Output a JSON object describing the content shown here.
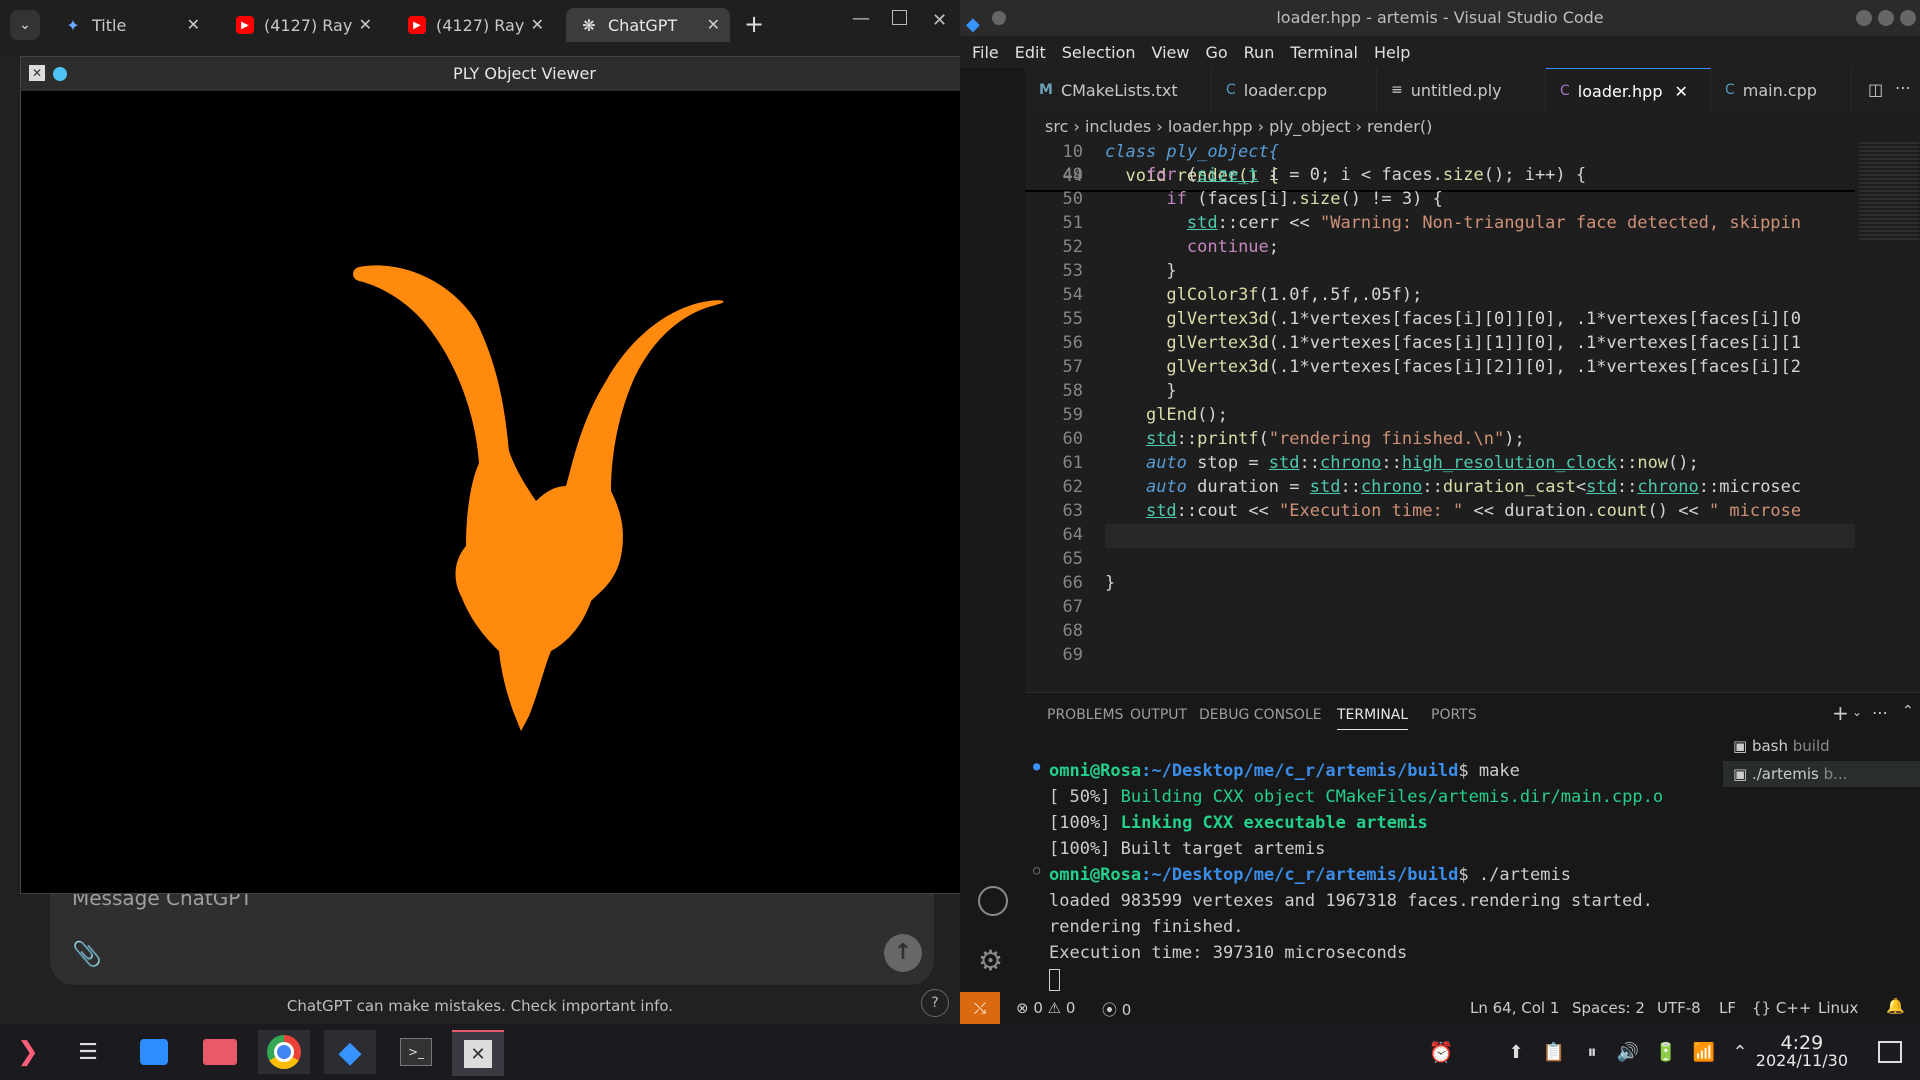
{
  "browser": {
    "tabs": [
      {
        "label": "Title"
      },
      {
        "label": "(4127) Ray"
      },
      {
        "label": "(4127) Ray"
      },
      {
        "label": "ChatGPT"
      }
    ],
    "message_placeholder": "Message ChatGPT",
    "disclaimer": "ChatGPT can make mistakes. Check important info.",
    "help_label": "?"
  },
  "viewer": {
    "title": "PLY Object Viewer",
    "model_color": "#ff8a0d"
  },
  "vscode": {
    "title": "loader.hpp - artemis - Visual Studio Code",
    "menu": [
      "File",
      "Edit",
      "Selection",
      "View",
      "Go",
      "Run",
      "Terminal",
      "Help"
    ],
    "tabs": [
      {
        "label": "CMakeLists.txt",
        "icon": "M"
      },
      {
        "label": "loader.cpp",
        "icon": "C"
      },
      {
        "label": "untitled.ply",
        "icon": "≡"
      },
      {
        "label": "loader.hpp",
        "icon": "C"
      },
      {
        "label": "main.cpp",
        "icon": "C"
      }
    ],
    "breadcrumb": {
      "folder1": "src",
      "folder2": "includes",
      "file": "loader.hpp",
      "symbol1": "ply_object",
      "symbol2": "render()"
    },
    "sticky": [
      {
        "num": "10",
        "text": "class ply_object{"
      },
      {
        "num": "44",
        "text": "  void render() {"
      }
    ],
    "code": [
      {
        "num": "49",
        "text": "    for (size_t i = 0; i < faces.size(); i++) {"
      },
      {
        "num": "50",
        "text": "      if (faces[i].size() != 3) {"
      },
      {
        "num": "51",
        "text": "        std::cerr << \"Warning: Non-triangular face detected, skippin"
      },
      {
        "num": "52",
        "text": "        continue;"
      },
      {
        "num": "53",
        "text": "      }"
      },
      {
        "num": "54",
        "text": "      glColor3f(1.0f,.5f,.05f);"
      },
      {
        "num": "55",
        "text": "      glVertex3d(.1*vertexes[faces[i][0]][0], .1*vertexes[faces[i][0"
      },
      {
        "num": "56",
        "text": "      glVertex3d(.1*vertexes[faces[i][1]][0], .1*vertexes[faces[i][1"
      },
      {
        "num": "57",
        "text": "      glVertex3d(.1*vertexes[faces[i][2]][0], .1*vertexes[faces[i][2"
      },
      {
        "num": "58",
        "text": "      }"
      },
      {
        "num": "59",
        "text": "    glEnd();"
      },
      {
        "num": "60",
        "text": "    std::printf(\"rendering finished.\\n\");"
      },
      {
        "num": "61",
        "text": "    auto stop = std::chrono::high_resolution_clock::now();"
      },
      {
        "num": "62",
        "text": "    auto duration = std::chrono::duration_cast<std::chrono::microsec"
      },
      {
        "num": "63",
        "text": "    std::cout << \"Execution time: \" << duration.count() << \" microse"
      },
      {
        "num": "64",
        "text": ""
      },
      {
        "num": "65",
        "text": ""
      },
      {
        "num": "66",
        "text": "}"
      },
      {
        "num": "67",
        "text": ""
      },
      {
        "num": "68",
        "text": ""
      },
      {
        "num": "69",
        "text": ""
      }
    ],
    "panel_tabs": [
      "PROBLEMS",
      "OUTPUT",
      "DEBUG CONSOLE",
      "TERMINAL",
      "PORTS"
    ],
    "terminals": [
      {
        "name": "bash",
        "task": "build"
      },
      {
        "name": "./artemis",
        "task": "b..."
      }
    ],
    "terminal_lines": {
      "prompt1_user": "omni@Rosa",
      "prompt1_path": ":~/Desktop/me/c_r/artemis/build",
      "prompt1_cmd": "$ make",
      "build1": "[ 50%] ",
      "build1_msg": "Building CXX object CMakeFiles/artemis.dir/main.cpp.o",
      "build2": "[100%] ",
      "build2_msg": "Linking CXX executable artemis",
      "build3": "[100%] Built target artemis",
      "prompt2_user": "omni@Rosa",
      "prompt2_path": ":~/Desktop/me/c_r/artemis/build",
      "prompt2_cmd": "$ ./artemis",
      "out1": "loaded 983599 vertexes and 1967318 faces.rendering started.",
      "out2": "rendering finished.",
      "out3": "Execution time: 397310 microseconds"
    },
    "status": {
      "errors": "0",
      "warnings": "0",
      "ports": "0",
      "position": "Ln 64, Col 1",
      "spaces": "Spaces: 2",
      "encoding": "UTF-8",
      "eol": "LF",
      "language": "C++",
      "platform": "Linux"
    }
  },
  "taskbar": {
    "time": "4:29",
    "date": "2024/11/30"
  }
}
